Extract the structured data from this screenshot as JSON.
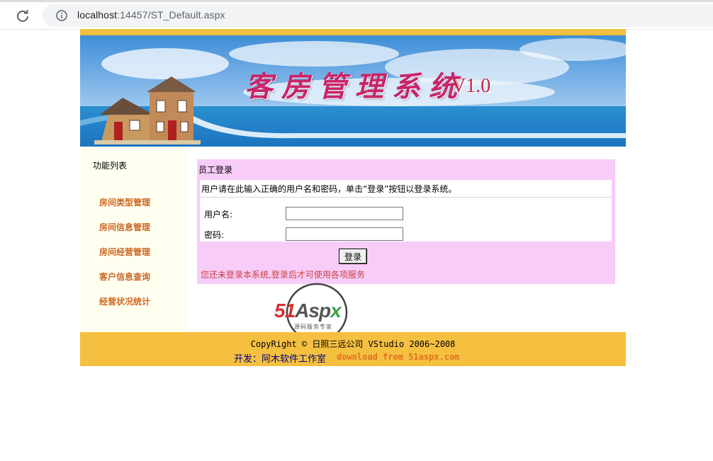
{
  "browser": {
    "url_host": "localhost",
    "url_rest": ":14457/ST_Default.aspx"
  },
  "banner": {
    "title": "客房管理系统",
    "version": "V1.0"
  },
  "sidebar": {
    "title": "功能列表",
    "items": [
      {
        "label": "房间类型管理"
      },
      {
        "label": "房间信息管理"
      },
      {
        "label": "房间经营管理"
      },
      {
        "label": "客户信息查询"
      },
      {
        "label": "经营状况统计"
      }
    ]
  },
  "login": {
    "header": "员工登录",
    "instruction": "用户请在此输入正确的用户名和密码，单击“登录”按钮以登录系统。",
    "username_label": "用户名:",
    "username_value": "",
    "password_label": "密码:",
    "password_value": "",
    "button_label": "登录",
    "status": "您还未登录本系统,登录后才可使用各项服务"
  },
  "watermark": {
    "brand_num": "51",
    "brand_a": "Asp",
    "brand_x": "x",
    "tagline": "源码服务专家"
  },
  "footer": {
    "copyright": "CopyRight © 日照三远公司 VStudio 2006~2008",
    "developer": "开发：阿木软件工作室",
    "download": "download from 51aspx.com"
  },
  "colors": {
    "top_stripe": "#f0c040",
    "footer_bg": "#f5c040",
    "login_panel_bg": "#f8ccf8",
    "sidebar_bg": "#fffff0",
    "sidebar_link": "#cc6622",
    "title_pink": "#c8246c"
  }
}
